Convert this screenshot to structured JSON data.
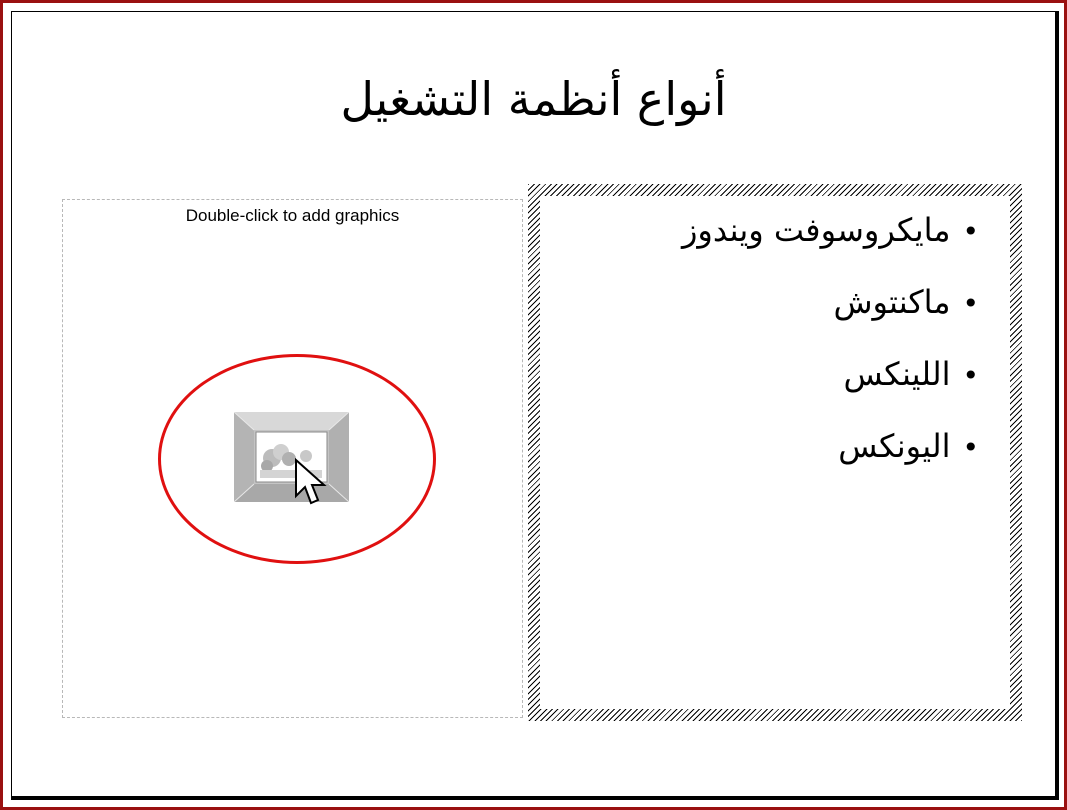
{
  "slide": {
    "title": "أنواع أنظمة التشغيل",
    "graphic_placeholder": {
      "hint": "Double-click to add graphics"
    },
    "bullet_symbol": "•",
    "bullets": [
      "مايكروسوفت ويندوز",
      "ماكنتوش",
      "اللينكس",
      "اليونكس"
    ]
  },
  "colors": {
    "frame_border": "#9a1010",
    "highlight_ellipse": "#e01010"
  },
  "icons": {
    "insert_picture": "insert-picture-icon",
    "cursor": "mouse-cursor-icon"
  }
}
